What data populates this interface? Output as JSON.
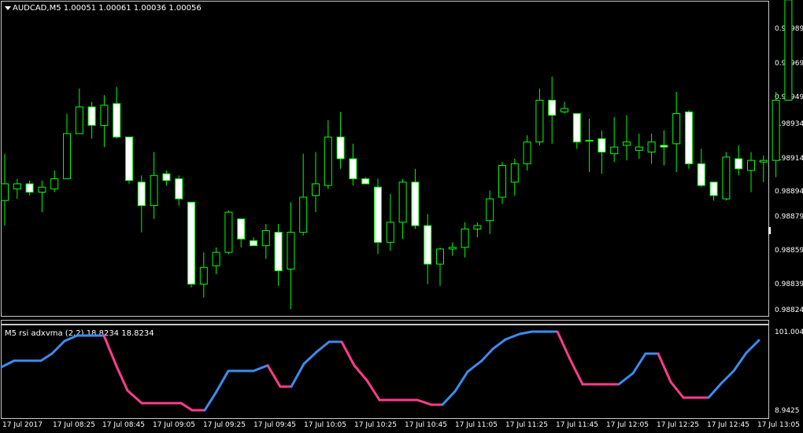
{
  "main_chart": {
    "header": "AUDCAD,M5  1.00051 1.00061 1.00036 1.00056",
    "price_axis": [
      "0.98989",
      "0.98969",
      "0.98949",
      "0.98934",
      "0.98914",
      "0.98894",
      "0.98879",
      "0.98859",
      "0.98839",
      "0.98824"
    ],
    "candle_up_color": "#00ff00",
    "candle_body_bull": "#000000",
    "candle_body_bear": "#ffffff"
  },
  "indicator": {
    "header": "M5 rsi adxvma (2,2) 18.8234 18.8234",
    "axis_top": "101.0045",
    "axis_bottom": "8.9425",
    "rising_color": "#3c8cf0",
    "falling_color": "#ff3c8c"
  },
  "time_axis": [
    "17 Jul 2017",
    "17 Jul 08:25",
    "17 Jul 08:45",
    "17 Jul 09:05",
    "17 Jul 09:25",
    "17 Jul 09:45",
    "17 Jul 10:05",
    "17 Jul 10:25",
    "17 Jul 10:45",
    "17 Jul 11:05",
    "17 Jul 11:25",
    "17 Jul 11:45",
    "17 Jul 12:05",
    "17 Jul 12:25",
    "17 Jul 12:45",
    "17 Jul 13:05"
  ],
  "chart_data": {
    "type": "candlestick",
    "symbol": "AUDCAD",
    "timeframe": "M5",
    "ylim": [
      0.98817,
      0.99005
    ],
    "candles": [
      {
        "o": 0.98886,
        "h": 0.98914,
        "l": 0.98871,
        "c": 0.98896
      },
      {
        "o": 0.98893,
        "h": 0.98899,
        "l": 0.98887,
        "c": 0.98896
      },
      {
        "o": 0.98896,
        "h": 0.98898,
        "l": 0.98889,
        "c": 0.98891
      },
      {
        "o": 0.98891,
        "h": 0.98898,
        "l": 0.98879,
        "c": 0.98894
      },
      {
        "o": 0.98893,
        "h": 0.98904,
        "l": 0.98891,
        "c": 0.98899
      },
      {
        "o": 0.98899,
        "h": 0.98938,
        "l": 0.98899,
        "c": 0.98926
      },
      {
        "o": 0.98926,
        "h": 0.98953,
        "l": 0.98926,
        "c": 0.98942
      },
      {
        "o": 0.98942,
        "h": 0.98945,
        "l": 0.98923,
        "c": 0.98931
      },
      {
        "o": 0.98931,
        "h": 0.98949,
        "l": 0.98918,
        "c": 0.98943
      },
      {
        "o": 0.98944,
        "h": 0.98954,
        "l": 0.98923,
        "c": 0.98924
      },
      {
        "o": 0.98924,
        "h": 0.98924,
        "l": 0.98896,
        "c": 0.98898
      },
      {
        "o": 0.98897,
        "h": 0.98901,
        "l": 0.98867,
        "c": 0.98883
      },
      {
        "o": 0.98883,
        "h": 0.98915,
        "l": 0.98875,
        "c": 0.98901
      },
      {
        "o": 0.98902,
        "h": 0.98904,
        "l": 0.98895,
        "c": 0.98898
      },
      {
        "o": 0.98899,
        "h": 0.98901,
        "l": 0.98883,
        "c": 0.98887
      },
      {
        "o": 0.98885,
        "h": 0.98885,
        "l": 0.98834,
        "c": 0.98836
      },
      {
        "o": 0.98836,
        "h": 0.98855,
        "l": 0.98828,
        "c": 0.98846
      },
      {
        "o": 0.98847,
        "h": 0.98858,
        "l": 0.98842,
        "c": 0.98855
      },
      {
        "o": 0.98855,
        "h": 0.9888,
        "l": 0.98854,
        "c": 0.98879
      },
      {
        "o": 0.98875,
        "h": 0.98875,
        "l": 0.98858,
        "c": 0.98863
      },
      {
        "o": 0.98862,
        "h": 0.98864,
        "l": 0.98859,
        "c": 0.98859
      },
      {
        "o": 0.98859,
        "h": 0.98872,
        "l": 0.98851,
        "c": 0.98868
      },
      {
        "o": 0.98867,
        "h": 0.98872,
        "l": 0.98835,
        "c": 0.98844
      },
      {
        "o": 0.98845,
        "h": 0.98885,
        "l": 0.98821,
        "c": 0.98867
      },
      {
        "o": 0.98867,
        "h": 0.98914,
        "l": 0.98865,
        "c": 0.98888
      },
      {
        "o": 0.98889,
        "h": 0.98915,
        "l": 0.98879,
        "c": 0.98896
      },
      {
        "o": 0.98895,
        "h": 0.98934,
        "l": 0.98893,
        "c": 0.98924
      },
      {
        "o": 0.98924,
        "h": 0.98939,
        "l": 0.98905,
        "c": 0.98911
      },
      {
        "o": 0.98911,
        "h": 0.9892,
        "l": 0.98895,
        "c": 0.98899
      },
      {
        "o": 0.98899,
        "h": 0.989,
        "l": 0.98897,
        "c": 0.98896
      },
      {
        "o": 0.98894,
        "h": 0.98899,
        "l": 0.98854,
        "c": 0.98861
      },
      {
        "o": 0.98861,
        "h": 0.9889,
        "l": 0.98856,
        "c": 0.98873
      },
      {
        "o": 0.98873,
        "h": 0.98899,
        "l": 0.98863,
        "c": 0.98897
      },
      {
        "o": 0.98897,
        "h": 0.98905,
        "l": 0.98869,
        "c": 0.98871
      },
      {
        "o": 0.98871,
        "h": 0.98878,
        "l": 0.98836,
        "c": 0.98848
      },
      {
        "o": 0.98848,
        "h": 0.98858,
        "l": 0.98835,
        "c": 0.98857
      },
      {
        "o": 0.98857,
        "h": 0.98861,
        "l": 0.98853,
        "c": 0.98858
      },
      {
        "o": 0.98858,
        "h": 0.98873,
        "l": 0.98852,
        "c": 0.98869
      },
      {
        "o": 0.98869,
        "h": 0.98873,
        "l": 0.98864,
        "c": 0.98871
      },
      {
        "o": 0.98874,
        "h": 0.98892,
        "l": 0.98866,
        "c": 0.98887
      },
      {
        "o": 0.98888,
        "h": 0.98909,
        "l": 0.98884,
        "c": 0.98907
      },
      {
        "o": 0.98897,
        "h": 0.98911,
        "l": 0.98889,
        "c": 0.98908
      },
      {
        "o": 0.98908,
        "h": 0.98925,
        "l": 0.98904,
        "c": 0.98921
      },
      {
        "o": 0.98921,
        "h": 0.98953,
        "l": 0.98919,
        "c": 0.98946
      },
      {
        "o": 0.98946,
        "h": 0.9896,
        "l": 0.9892,
        "c": 0.98937
      },
      {
        "o": 0.98939,
        "h": 0.98945,
        "l": 0.98938,
        "c": 0.98941
      },
      {
        "o": 0.98938,
        "h": 0.98938,
        "l": 0.98917,
        "c": 0.98921
      },
      {
        "o": 0.98922,
        "h": 0.98935,
        "l": 0.98903,
        "c": 0.98922
      },
      {
        "o": 0.98923,
        "h": 0.98928,
        "l": 0.98902,
        "c": 0.98915
      },
      {
        "o": 0.98914,
        "h": 0.98936,
        "l": 0.98909,
        "c": 0.98918
      },
      {
        "o": 0.98919,
        "h": 0.98937,
        "l": 0.9891,
        "c": 0.98921
      },
      {
        "o": 0.98916,
        "h": 0.98926,
        "l": 0.98911,
        "c": 0.98918
      },
      {
        "o": 0.98915,
        "h": 0.98926,
        "l": 0.98908,
        "c": 0.98921
      },
      {
        "o": 0.98919,
        "h": 0.98928,
        "l": 0.98907,
        "c": 0.98918
      },
      {
        "o": 0.9892,
        "h": 0.98951,
        "l": 0.98903,
        "c": 0.98938
      },
      {
        "o": 0.98939,
        "h": 0.9894,
        "l": 0.98905,
        "c": 0.98908
      },
      {
        "o": 0.98908,
        "h": 0.98917,
        "l": 0.98894,
        "c": 0.98895
      },
      {
        "o": 0.98897,
        "h": 0.98897,
        "l": 0.98886,
        "c": 0.98889
      },
      {
        "o": 0.98887,
        "h": 0.98915,
        "l": 0.98886,
        "c": 0.98912
      },
      {
        "o": 0.98911,
        "h": 0.98919,
        "l": 0.98901,
        "c": 0.98905
      },
      {
        "o": 0.98904,
        "h": 0.98915,
        "l": 0.98891,
        "c": 0.9891
      },
      {
        "o": 0.98909,
        "h": 0.98913,
        "l": 0.98897,
        "c": 0.9891
      },
      {
        "o": 0.9891,
        "h": 0.98951,
        "l": 0.989,
        "c": 0.98946
      },
      {
        "o": 0.98946,
        "h": 0.99006,
        "l": 0.98956,
        "c": 0.99006
      }
    ],
    "indicator": {
      "name": "rsi adxvma (2,2)",
      "last_values": [
        18.8234,
        18.8234
      ],
      "ylim": [
        8.9425,
        101.0045
      ]
    }
  }
}
